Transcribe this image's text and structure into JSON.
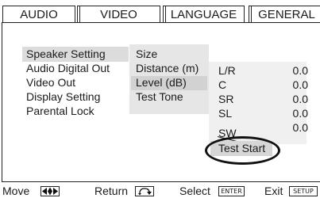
{
  "tabs": {
    "audio": "AUDIO",
    "video": "VIDEO",
    "language": "LANGUAGE",
    "general": "GENERAL",
    "active": "general"
  },
  "main_menu": {
    "items": [
      "Speaker Setting",
      "Audio Digital Out",
      "Video Out",
      "Display Setting",
      "Parental Lock"
    ],
    "selected": "Speaker Setting"
  },
  "sub_menu": {
    "items": [
      "Size",
      "Distance (m)",
      "Level (dB)",
      "Test Tone"
    ],
    "selected": "Level (dB)"
  },
  "levels": {
    "channels": [
      {
        "label": "L/R",
        "value": "0.0"
      },
      {
        "label": "C",
        "value": "0.0"
      },
      {
        "label": "SR",
        "value": "0.0"
      },
      {
        "label": "SL",
        "value": "0.0"
      },
      {
        "label": "SW",
        "value": "0.0"
      }
    ],
    "test_start": "Test Start"
  },
  "footer": {
    "move": "Move",
    "return": "Return",
    "select": "Select",
    "select_key": "ENTER",
    "exit": "Exit",
    "exit_key": "SETUP"
  },
  "colors": {
    "main_highlight": "#dcdcdc",
    "submenu_background": "#e6e6e6",
    "submenu_highlight": "#d2d2d2",
    "test_start_highlight": "#d6d6d6"
  },
  "icons": {
    "move": "four-way-arrows-icon",
    "return": "return-key-icon"
  }
}
